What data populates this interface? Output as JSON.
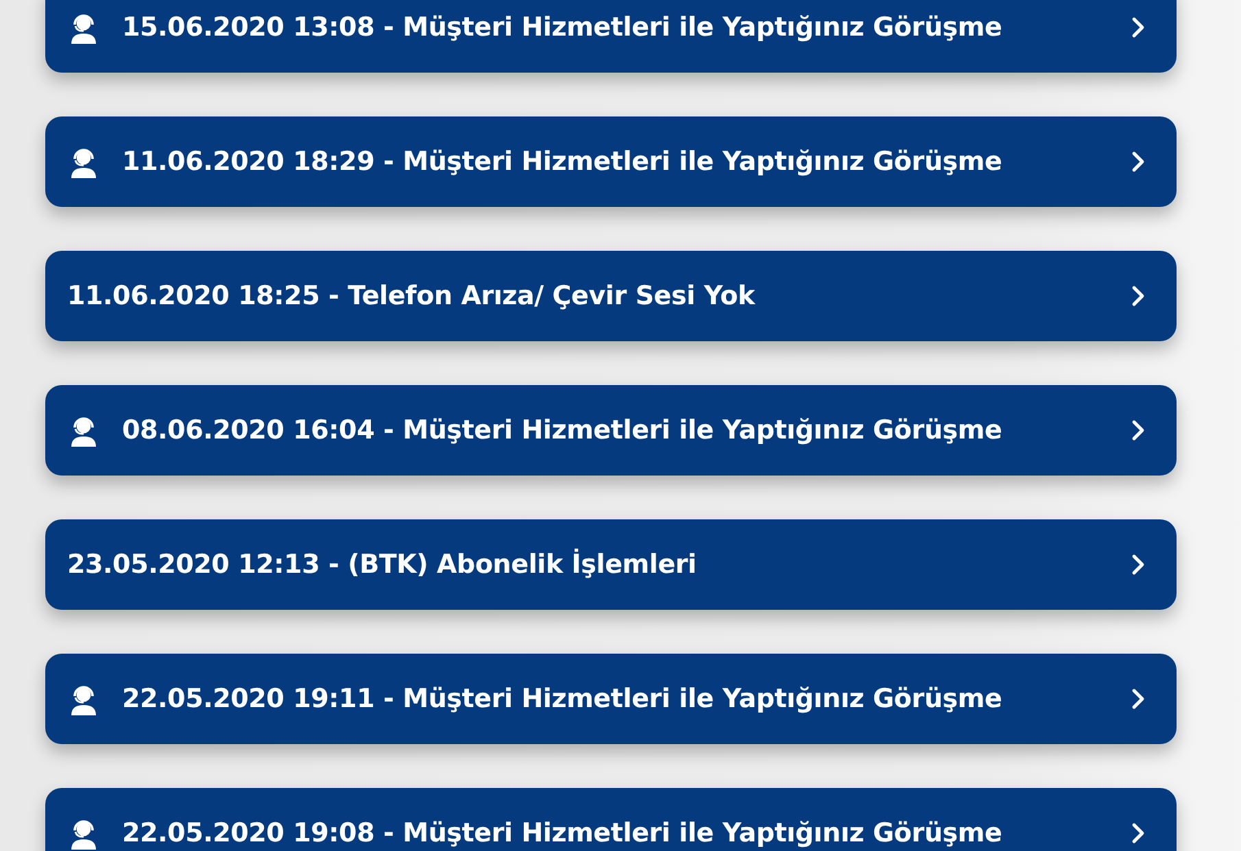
{
  "records": [
    {
      "kind": "call",
      "label": "15.06.2020 13:08 - Müşteri Hizmetleri ile Yaptığınız Görüşme"
    },
    {
      "kind": "call",
      "label": "11.06.2020 18:29 - Müşteri Hizmetleri ile Yaptığınız Görüşme"
    },
    {
      "kind": "ticket",
      "label": "11.06.2020 18:25 - Telefon Arıza/ Çevir Sesi Yok"
    },
    {
      "kind": "call",
      "label": "08.06.2020 16:04 - Müşteri Hizmetleri ile Yaptığınız Görüşme"
    },
    {
      "kind": "ticket",
      "label": "23.05.2020 12:13 - (BTK) Abonelik İşlemleri"
    },
    {
      "kind": "call",
      "label": "22.05.2020 19:11 - Müşteri Hizmetleri ile Yaptığınız Görüşme"
    },
    {
      "kind": "call",
      "label": "22.05.2020 19:08 - Müşteri Hizmetleri ile Yaptığınız Görüşme"
    }
  ]
}
